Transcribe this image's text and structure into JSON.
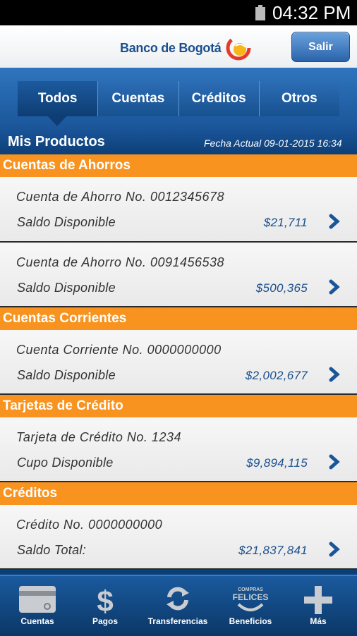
{
  "status_bar": {
    "time": "04:32 PM"
  },
  "header": {
    "logo_text": "Banco de Bogotá",
    "logout_label": "Salir"
  },
  "tabs": [
    {
      "label": "Todos",
      "active": true
    },
    {
      "label": "Cuentas",
      "active": false
    },
    {
      "label": "Créditos",
      "active": false
    },
    {
      "label": "Otros",
      "active": false
    }
  ],
  "products_header": {
    "title": "Mis Productos",
    "date_text": "Fecha Actual 09-01-2015 16:34"
  },
  "sections": [
    {
      "title": "Cuentas de Ahorros",
      "items": [
        {
          "name": "Cuenta de Ahorro No. 0012345678",
          "label": "Saldo Disponible",
          "amount": "$21,711"
        },
        {
          "name": "Cuenta de Ahorro No. 0091456538",
          "label": "Saldo Disponible",
          "amount": "$500,365"
        }
      ]
    },
    {
      "title": "Cuentas Corrientes",
      "items": [
        {
          "name": "Cuenta Corriente No. 0000000000",
          "label": "Saldo Disponible",
          "amount": "$2,002,677"
        }
      ]
    },
    {
      "title": "Tarjetas de Crédito",
      "items": [
        {
          "name": "Tarjeta de Crédito No. 1234",
          "label": "Cupo Disponible",
          "amount": "$9,894,115"
        }
      ]
    },
    {
      "title": "Créditos",
      "items": [
        {
          "name": "Crédito No. 0000000000",
          "label": "Saldo Total:",
          "amount": "$21,837,841"
        }
      ]
    }
  ],
  "bottom_nav": [
    {
      "label": "Cuentas",
      "icon": "card-icon"
    },
    {
      "label": "Pagos",
      "icon": "dollar-icon"
    },
    {
      "label": "Transferencias",
      "icon": "transfer-arrows-icon"
    },
    {
      "label": "Beneficios",
      "icon": "compras-felices-icon",
      "icon_text": "COMPRAS FELICES"
    },
    {
      "label": "Más",
      "icon": "plus-icon"
    }
  ],
  "colors": {
    "brand_blue": "#1a5599",
    "section_orange": "#f7931e",
    "amount_blue": "#1a4f8c"
  }
}
